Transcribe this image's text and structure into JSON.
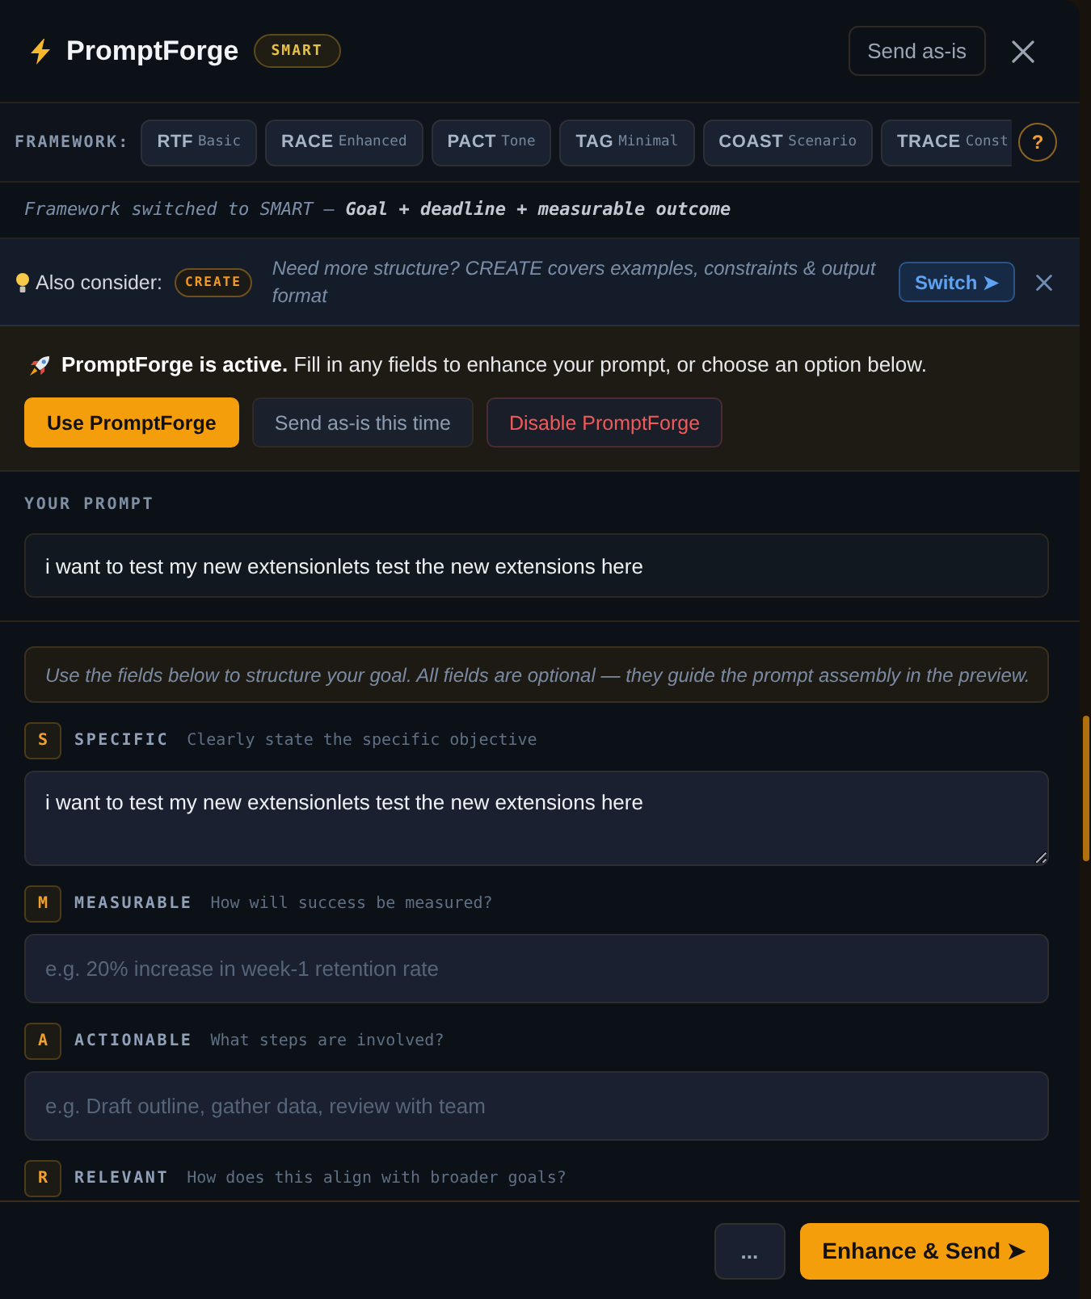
{
  "header": {
    "title": "PromptForge",
    "badge": "SMART",
    "send_button": "Send as-is"
  },
  "framework_bar": {
    "label": "FRAMEWORK:",
    "options": [
      {
        "name": "RTF",
        "sub": "Basic",
        "selected": false
      },
      {
        "name": "RACE",
        "sub": "Enhanced",
        "selected": false
      },
      {
        "name": "PACT",
        "sub": "Tone",
        "selected": false
      },
      {
        "name": "TAG",
        "sub": "Minimal",
        "selected": false
      },
      {
        "name": "COAST",
        "sub": "Scenario",
        "selected": false
      },
      {
        "name": "TRACE",
        "sub": "Const",
        "selected": false
      }
    ],
    "help_button": "?"
  },
  "notice": "Framework switched to SMART — **Goal + deadline + measurable outcome**",
  "suggestion": {
    "label": "Also consider:",
    "badge": "CREATE",
    "text": "Need more structure? CREATE covers examples, constraints & output format",
    "button": "Switch ➤"
  },
  "banner": {
    "message": "**PromptForge is active.** Fill in any fields to enhance your prompt, or choose an option below.",
    "buttons": [
      {
        "label": "Use PromptForge",
        "kind": "primary"
      },
      {
        "label": "Send as-is this time",
        "kind": "secondary"
      },
      {
        "label": "Disable PromptForge",
        "kind": "danger"
      }
    ]
  },
  "prompt": {
    "label": "YOUR PROMPT",
    "value": "i want to test my new extensionlets test the new extensions here"
  },
  "hint_box": "Use the fields below to structure your goal. All fields are optional — they guide the prompt assembly in the preview.",
  "fields": [
    {
      "letter": "S",
      "label": "SPECIFIC",
      "hint": "Clearly state the specific objective",
      "kind": "textarea",
      "value": "i want to test my new extensionlets test the new extensions here"
    },
    {
      "letter": "M",
      "label": "MEASURABLE",
      "hint": "How will success be measured?",
      "kind": "input",
      "placeholder": "e.g. 20% increase in week-1 retention rate"
    },
    {
      "letter": "A",
      "label": "ACTIONABLE",
      "hint": "What steps are involved?",
      "kind": "input",
      "placeholder": "e.g. Draft outline, gather data, review with team"
    },
    {
      "letter": "R",
      "label": "RELEVANT",
      "hint": "How does this align with broader goals?"
    }
  ],
  "footer": {
    "more_button": "...",
    "primary_button": "Enhance & Send ➤"
  }
}
